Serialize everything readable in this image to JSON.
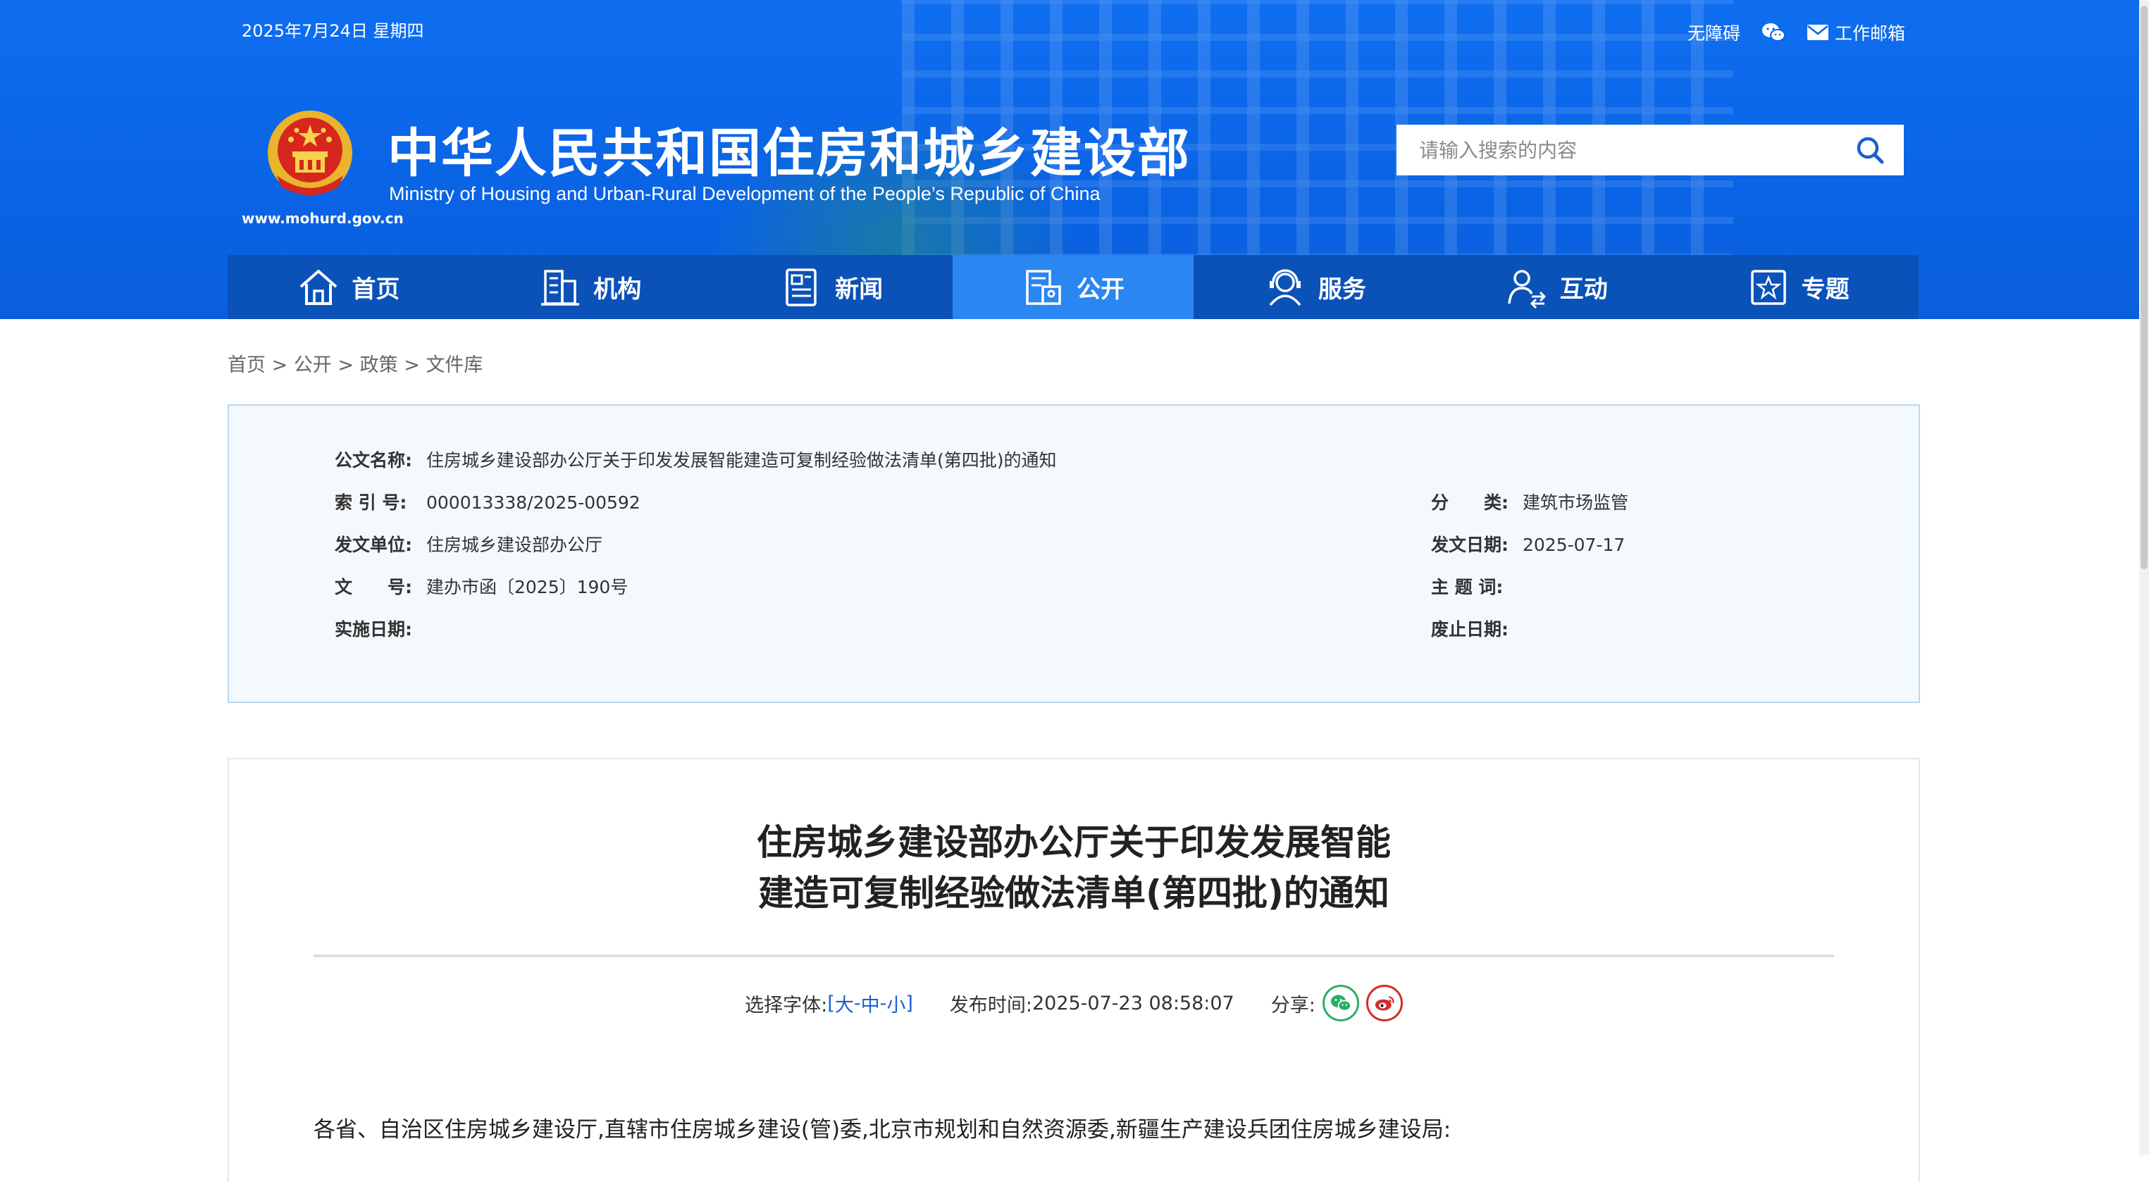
{
  "header": {
    "date": "2025年7月24日 星期四",
    "accessibility": "无障碍",
    "mail": "工作邮箱",
    "site_title": "中华人民共和国住房和城乡建设部",
    "site_subtitle": "Ministry of Housing and Urban-Rural Development of the People’s Republic of China",
    "site_url": "www.mohurd.gov.cn",
    "search_placeholder": "请输入搜索的内容"
  },
  "nav": [
    {
      "label": "首页",
      "icon": "home-icon",
      "active": false
    },
    {
      "label": "机构",
      "icon": "building-icon",
      "active": false
    },
    {
      "label": "新闻",
      "icon": "news-icon",
      "active": false
    },
    {
      "label": "公开",
      "icon": "disclosure-icon",
      "active": true
    },
    {
      "label": "服务",
      "icon": "service-icon",
      "active": false
    },
    {
      "label": "互动",
      "icon": "interaction-icon",
      "active": false
    },
    {
      "label": "专题",
      "icon": "topic-icon",
      "active": false
    }
  ],
  "breadcrumb": [
    "首页",
    "公开",
    "政策",
    "文件库"
  ],
  "info": {
    "name_label": "公文名称:",
    "name_value": "住房城乡建设部办公厅关于印发发展智能建造可复制经验做法清单(第四批)的通知",
    "index_label": "索 引 号:",
    "index_value": "000013338/2025-00592",
    "category_label": "分　　类:",
    "category_value": "建筑市场监管",
    "issuer_label": "发文单位:",
    "issuer_value": "住房城乡建设部办公厅",
    "date_label": "发文日期:",
    "date_value": "2025-07-17",
    "docno_label": "文　　号:",
    "docno_value": "建办市函〔2025〕190号",
    "keywords_label": "主 题 词:",
    "keywords_value": "",
    "effective_label": "实施日期:",
    "effective_value": "",
    "expiry_label": "废止日期:",
    "expiry_value": ""
  },
  "article": {
    "title_line1": "住房城乡建设部办公厅关于印发发展智能",
    "title_line2": "建造可复制经验做法清单(第四批)的通知",
    "font_label": "选择字体:",
    "font_open": "[",
    "font_large": "大",
    "font_mid": "中",
    "font_small": "小",
    "font_sep": "-",
    "font_close": "]",
    "publish_label": "发布时间:",
    "publish_time": "2025-07-23 08:58:07",
    "share_label": "分享:",
    "salutation": "各省、自治区住房城乡建设厅,直辖市住房城乡建设(管)委,北京市规划和自然资源委,新疆生产建设兵团住房城乡建设局:"
  },
  "colors": {
    "header_blue": "#0a64e6",
    "nav_blue": "#0b52b8",
    "nav_active": "#2a86f0",
    "wechat_green": "#2aae67",
    "weibo_red": "#d52b2b"
  }
}
